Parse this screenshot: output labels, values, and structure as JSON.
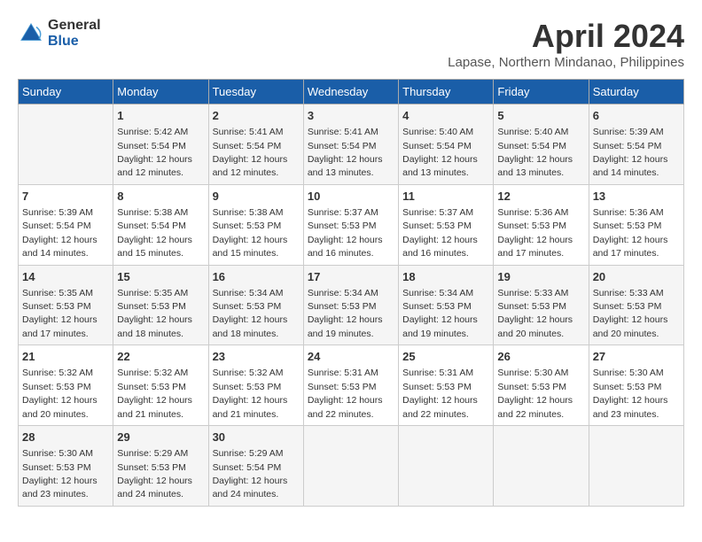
{
  "logo": {
    "general": "General",
    "blue": "Blue"
  },
  "title": "April 2024",
  "subtitle": "Lapase, Northern Mindanao, Philippines",
  "days_of_week": [
    "Sunday",
    "Monday",
    "Tuesday",
    "Wednesday",
    "Thursday",
    "Friday",
    "Saturday"
  ],
  "weeks": [
    [
      {
        "day": "",
        "info": ""
      },
      {
        "day": "1",
        "info": "Sunrise: 5:42 AM\nSunset: 5:54 PM\nDaylight: 12 hours\nand 12 minutes."
      },
      {
        "day": "2",
        "info": "Sunrise: 5:41 AM\nSunset: 5:54 PM\nDaylight: 12 hours\nand 12 minutes."
      },
      {
        "day": "3",
        "info": "Sunrise: 5:41 AM\nSunset: 5:54 PM\nDaylight: 12 hours\nand 13 minutes."
      },
      {
        "day": "4",
        "info": "Sunrise: 5:40 AM\nSunset: 5:54 PM\nDaylight: 12 hours\nand 13 minutes."
      },
      {
        "day": "5",
        "info": "Sunrise: 5:40 AM\nSunset: 5:54 PM\nDaylight: 12 hours\nand 13 minutes."
      },
      {
        "day": "6",
        "info": "Sunrise: 5:39 AM\nSunset: 5:54 PM\nDaylight: 12 hours\nand 14 minutes."
      }
    ],
    [
      {
        "day": "7",
        "info": "Sunrise: 5:39 AM\nSunset: 5:54 PM\nDaylight: 12 hours\nand 14 minutes."
      },
      {
        "day": "8",
        "info": "Sunrise: 5:38 AM\nSunset: 5:54 PM\nDaylight: 12 hours\nand 15 minutes."
      },
      {
        "day": "9",
        "info": "Sunrise: 5:38 AM\nSunset: 5:53 PM\nDaylight: 12 hours\nand 15 minutes."
      },
      {
        "day": "10",
        "info": "Sunrise: 5:37 AM\nSunset: 5:53 PM\nDaylight: 12 hours\nand 16 minutes."
      },
      {
        "day": "11",
        "info": "Sunrise: 5:37 AM\nSunset: 5:53 PM\nDaylight: 12 hours\nand 16 minutes."
      },
      {
        "day": "12",
        "info": "Sunrise: 5:36 AM\nSunset: 5:53 PM\nDaylight: 12 hours\nand 17 minutes."
      },
      {
        "day": "13",
        "info": "Sunrise: 5:36 AM\nSunset: 5:53 PM\nDaylight: 12 hours\nand 17 minutes."
      }
    ],
    [
      {
        "day": "14",
        "info": "Sunrise: 5:35 AM\nSunset: 5:53 PM\nDaylight: 12 hours\nand 17 minutes."
      },
      {
        "day": "15",
        "info": "Sunrise: 5:35 AM\nSunset: 5:53 PM\nDaylight: 12 hours\nand 18 minutes."
      },
      {
        "day": "16",
        "info": "Sunrise: 5:34 AM\nSunset: 5:53 PM\nDaylight: 12 hours\nand 18 minutes."
      },
      {
        "day": "17",
        "info": "Sunrise: 5:34 AM\nSunset: 5:53 PM\nDaylight: 12 hours\nand 19 minutes."
      },
      {
        "day": "18",
        "info": "Sunrise: 5:34 AM\nSunset: 5:53 PM\nDaylight: 12 hours\nand 19 minutes."
      },
      {
        "day": "19",
        "info": "Sunrise: 5:33 AM\nSunset: 5:53 PM\nDaylight: 12 hours\nand 20 minutes."
      },
      {
        "day": "20",
        "info": "Sunrise: 5:33 AM\nSunset: 5:53 PM\nDaylight: 12 hours\nand 20 minutes."
      }
    ],
    [
      {
        "day": "21",
        "info": "Sunrise: 5:32 AM\nSunset: 5:53 PM\nDaylight: 12 hours\nand 20 minutes."
      },
      {
        "day": "22",
        "info": "Sunrise: 5:32 AM\nSunset: 5:53 PM\nDaylight: 12 hours\nand 21 minutes."
      },
      {
        "day": "23",
        "info": "Sunrise: 5:32 AM\nSunset: 5:53 PM\nDaylight: 12 hours\nand 21 minutes."
      },
      {
        "day": "24",
        "info": "Sunrise: 5:31 AM\nSunset: 5:53 PM\nDaylight: 12 hours\nand 22 minutes."
      },
      {
        "day": "25",
        "info": "Sunrise: 5:31 AM\nSunset: 5:53 PM\nDaylight: 12 hours\nand 22 minutes."
      },
      {
        "day": "26",
        "info": "Sunrise: 5:30 AM\nSunset: 5:53 PM\nDaylight: 12 hours\nand 22 minutes."
      },
      {
        "day": "27",
        "info": "Sunrise: 5:30 AM\nSunset: 5:53 PM\nDaylight: 12 hours\nand 23 minutes."
      }
    ],
    [
      {
        "day": "28",
        "info": "Sunrise: 5:30 AM\nSunset: 5:53 PM\nDaylight: 12 hours\nand 23 minutes."
      },
      {
        "day": "29",
        "info": "Sunrise: 5:29 AM\nSunset: 5:53 PM\nDaylight: 12 hours\nand 24 minutes."
      },
      {
        "day": "30",
        "info": "Sunrise: 5:29 AM\nSunset: 5:54 PM\nDaylight: 12 hours\nand 24 minutes."
      },
      {
        "day": "",
        "info": ""
      },
      {
        "day": "",
        "info": ""
      },
      {
        "day": "",
        "info": ""
      },
      {
        "day": "",
        "info": ""
      }
    ]
  ]
}
